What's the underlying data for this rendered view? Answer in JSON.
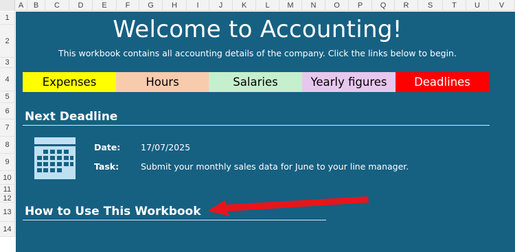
{
  "columns": [
    "A",
    "B",
    "C",
    "D",
    "E",
    "F",
    "G",
    "H",
    "I",
    "J",
    "K",
    "L",
    "M",
    "N",
    "O",
    "P",
    "Q",
    "R",
    "S",
    "T",
    "U",
    "V"
  ],
  "rows": [
    "1",
    "2",
    "3",
    "4",
    "5",
    "6",
    "7",
    "8",
    "9",
    "10",
    "11",
    "12",
    "13",
    "14"
  ],
  "header": {
    "title": "Welcome to Accounting!",
    "subtitle": "This workbook contains all accounting details of the company. Click the links below to begin."
  },
  "nav": [
    {
      "label": "Expenses",
      "bg": "#ffff00",
      "fg": "#000000"
    },
    {
      "label": "Hours",
      "bg": "#f8cbad",
      "fg": "#000000"
    },
    {
      "label": "Salaries",
      "bg": "#c6efce",
      "fg": "#000000"
    },
    {
      "label": "Yearly figures",
      "bg": "#e8c7ee",
      "fg": "#000000"
    },
    {
      "label": "Deadlines",
      "bg": "#ff0000",
      "fg": "#ffffff"
    }
  ],
  "next_deadline": {
    "heading": "Next Deadline",
    "icon": "calendar-icon",
    "date_label": "Date:",
    "date_value": "17/07/2025",
    "task_label": "Task:",
    "task_value": "Submit your monthly sales data for June to your line manager."
  },
  "how_to": {
    "heading": "How to Use This Workbook",
    "pointer_icon": "red-arrow-icon",
    "pointer_color": "#e8151b"
  },
  "colors": {
    "sheet_bg": "#166082",
    "text": "#ffffff"
  }
}
